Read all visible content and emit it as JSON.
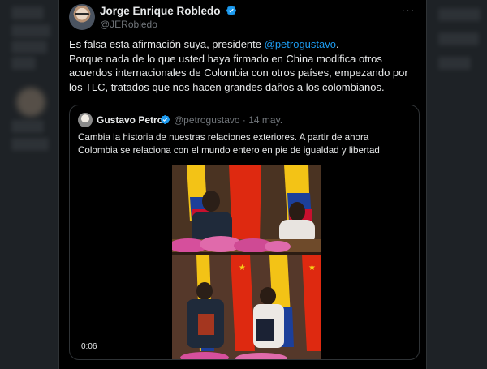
{
  "tweet": {
    "author_name": "Jorge Enrique Robledo",
    "author_handle": "@JERobledo",
    "text_before_mention": "Es falsa esta afirmación suya, presidente ",
    "mention": "@petrogustavo",
    "text_after_mention": ".",
    "text_line2": "Porque nada de lo que usted haya firmado en China modifica otros acuerdos internacionales de Colombia con otros países, empezando por los TLC, tratados que nos hacen grandes daños a los colombianos."
  },
  "quoted": {
    "author_name": "Gustavo Petro",
    "handle_and_date": "@petrogustavo · 14 may.",
    "text": "Cambia la historia de nuestras relaciones exteriores. A partir de ahora Colombia se relaciona con el mundo entero en pie de igualdad y libertad",
    "video_time": "0:06"
  },
  "colors": {
    "verified_blue": "#1d9bf0",
    "link_blue": "#1d9bf0",
    "background": "#000000"
  },
  "icons": {
    "more": "more-icon",
    "verified": "verified-badge-icon"
  }
}
